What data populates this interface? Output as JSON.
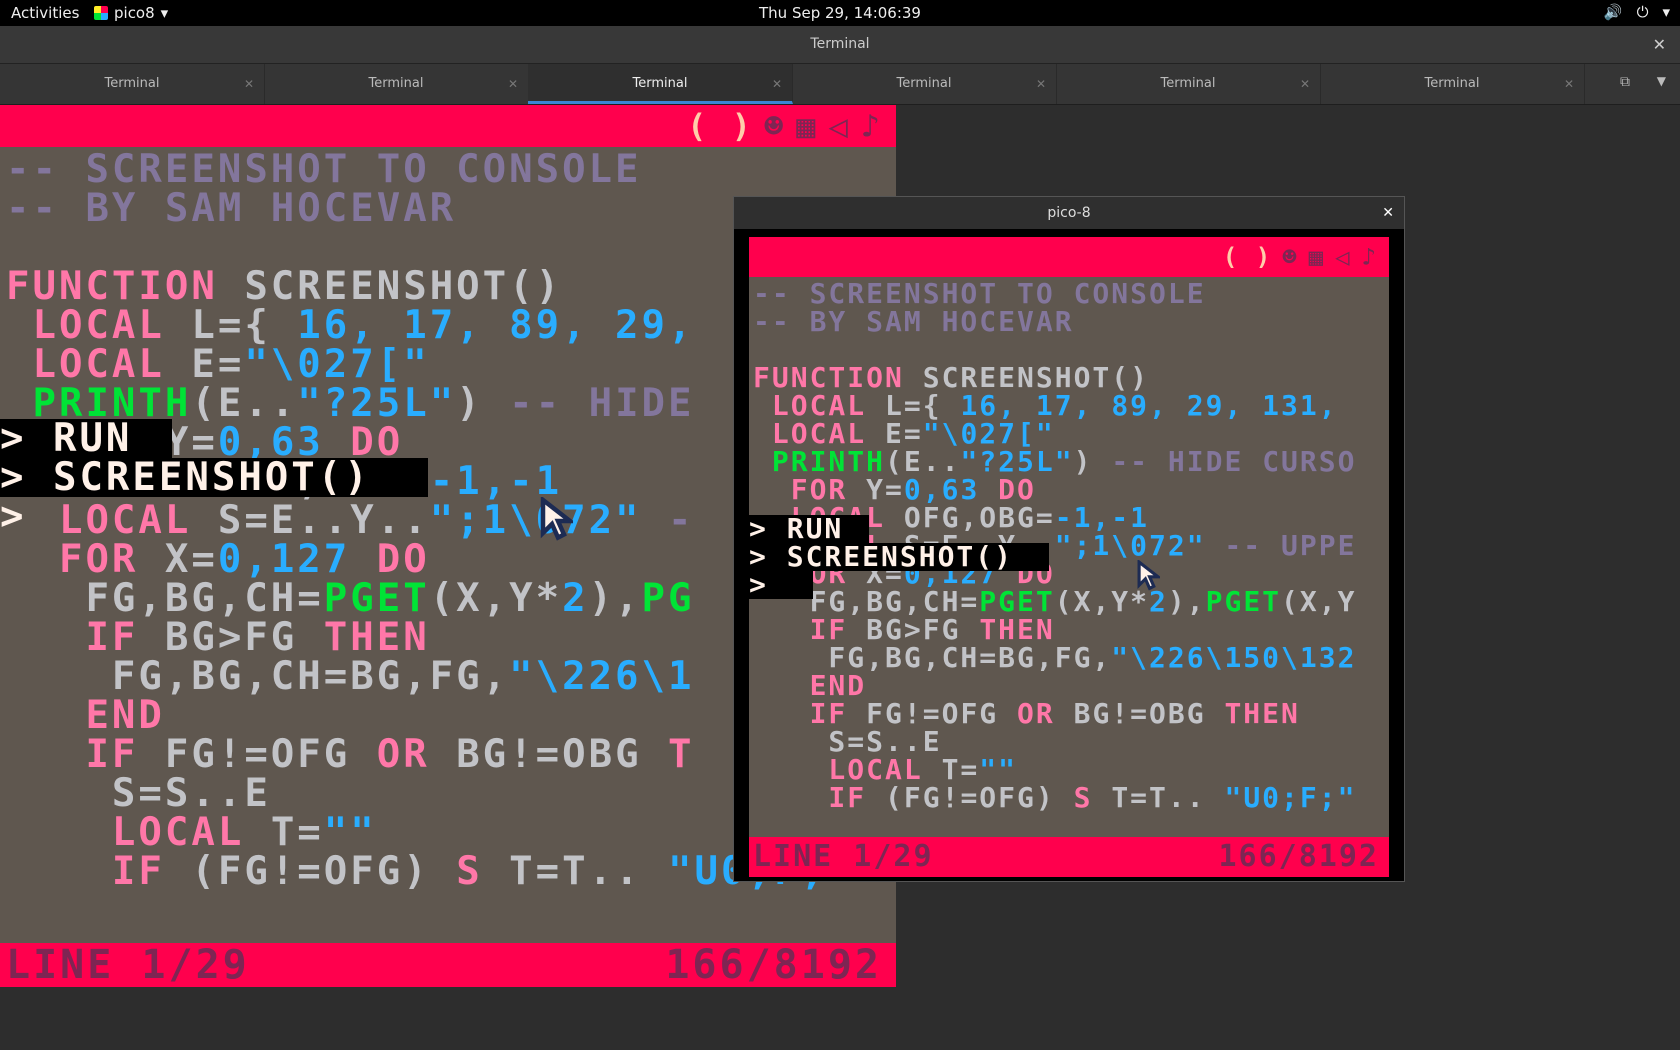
{
  "topbar": {
    "activities": "Activities",
    "app_name": "pico8",
    "app_menu_arrow": "▾",
    "clock": "Thu Sep 29, 14:06:39",
    "icons": [
      "volume-icon",
      "power-icon"
    ]
  },
  "terminal": {
    "title": "Terminal",
    "tabs": [
      {
        "label": "Terminal"
      },
      {
        "label": "Terminal"
      },
      {
        "label": "Terminal"
      },
      {
        "label": "Terminal"
      },
      {
        "label": "Terminal"
      },
      {
        "label": "Terminal"
      }
    ],
    "active_tab_index": 2
  },
  "pico_window": {
    "title": "pico-8"
  },
  "pico": {
    "editor_icons": [
      "( )",
      "☻",
      "▦",
      "◁",
      "♪"
    ],
    "status_left": "LINE 1/29",
    "status_right": "166/8192",
    "code_left": [
      {
        "parts": [
          [
            "cmt",
            "-- SCREENSHOT TO CONSOLE"
          ]
        ]
      },
      {
        "parts": [
          [
            "cmt",
            "-- BY SAM HOCEVAR"
          ]
        ]
      },
      {
        "parts": [
          [
            "id",
            ""
          ]
        ]
      },
      {
        "parts": [
          [
            "kw",
            "FUNCTION "
          ],
          [
            "id",
            "SCREENSHOT()"
          ]
        ]
      },
      {
        "parts": [
          [
            "kw",
            " LOCAL "
          ],
          [
            "id",
            "L={ "
          ],
          [
            "num",
            "16, 17, 89, 29,"
          ]
        ]
      },
      {
        "parts": [
          [
            "kw",
            " LOCAL "
          ],
          [
            "id",
            "E="
          ],
          [
            "str",
            "\"\\027[\""
          ]
        ]
      },
      {
        "parts": [
          [
            "fn",
            " PRINTH"
          ],
          [
            "id",
            "(E.."
          ],
          [
            "str",
            "\"?25L\""
          ],
          [
            "id",
            ") "
          ],
          [
            "cmt",
            "-- HIDE"
          ]
        ]
      },
      {
        "parts": [
          [
            "kw",
            "  FOR "
          ],
          [
            "id",
            "Y="
          ],
          [
            "num",
            "0,63 "
          ],
          [
            "kw",
            "DO"
          ]
        ]
      },
      {
        "parts": [
          [
            "kw",
            "  LOCAL "
          ],
          [
            "id",
            "OFG,OBG="
          ],
          [
            "num",
            "-1,-1"
          ]
        ]
      },
      {
        "parts": [
          [
            "kw",
            "  LOCAL "
          ],
          [
            "id",
            "S=E..Y.."
          ],
          [
            "str",
            "\";1\\072\""
          ],
          [
            "cmt",
            " -"
          ]
        ]
      },
      {
        "parts": [
          [
            "kw",
            "  FOR "
          ],
          [
            "id",
            "X="
          ],
          [
            "num",
            "0,127 "
          ],
          [
            "kw",
            "DO"
          ]
        ]
      },
      {
        "parts": [
          [
            "id",
            "   FG,BG,CH="
          ],
          [
            "fn",
            "PGET"
          ],
          [
            "id",
            "(X,Y*"
          ],
          [
            "num",
            "2"
          ],
          [
            "id",
            "),"
          ],
          [
            "fn",
            "PG"
          ]
        ]
      },
      {
        "parts": [
          [
            "kw",
            "   IF "
          ],
          [
            "id",
            "BG>FG "
          ],
          [
            "kw",
            "THEN"
          ]
        ]
      },
      {
        "parts": [
          [
            "id",
            "    FG,BG,CH=BG,FG,"
          ],
          [
            "str",
            "\"\\226\\1"
          ]
        ]
      },
      {
        "parts": [
          [
            "kw",
            "   END"
          ]
        ]
      },
      {
        "parts": [
          [
            "kw",
            "   IF "
          ],
          [
            "id",
            "FG!=OFG "
          ],
          [
            "kw",
            "OR "
          ],
          [
            "id",
            "BG!=OBG "
          ],
          [
            "kw",
            "T"
          ]
        ]
      },
      {
        "parts": [
          [
            "id",
            "    S=S..E"
          ]
        ]
      },
      {
        "parts": [
          [
            "kw",
            "    LOCAL "
          ],
          [
            "id",
            "T="
          ],
          [
            "str",
            "\"\""
          ]
        ]
      },
      {
        "parts": [
          [
            "kw",
            "    IF "
          ],
          [
            "id",
            "(FG!=OFG) "
          ],
          [
            "kw",
            "S "
          ],
          [
            "id",
            "T=T.. "
          ],
          [
            "str",
            "\"U0;F;\""
          ]
        ]
      }
    ],
    "code_right": [
      {
        "parts": [
          [
            "cmt",
            "-- SCREENSHOT TO CONSOLE"
          ]
        ]
      },
      {
        "parts": [
          [
            "cmt",
            "-- BY SAM HOCEVAR"
          ]
        ]
      },
      {
        "parts": [
          [
            "id",
            ""
          ]
        ]
      },
      {
        "parts": [
          [
            "kw",
            "FUNCTION "
          ],
          [
            "id",
            "SCREENSHOT()"
          ]
        ]
      },
      {
        "parts": [
          [
            "kw",
            " LOCAL "
          ],
          [
            "id",
            "L={ "
          ],
          [
            "num",
            "16, 17, 89, 29, 131,"
          ]
        ]
      },
      {
        "parts": [
          [
            "kw",
            " LOCAL "
          ],
          [
            "id",
            "E="
          ],
          [
            "str",
            "\"\\027[\""
          ]
        ]
      },
      {
        "parts": [
          [
            "fn",
            " PRINTH"
          ],
          [
            "id",
            "(E.."
          ],
          [
            "str",
            "\"?25L\""
          ],
          [
            "id",
            ") "
          ],
          [
            "cmt",
            "-- HIDE CURSO"
          ]
        ]
      },
      {
        "parts": [
          [
            "kw",
            "  FOR "
          ],
          [
            "id",
            "Y="
          ],
          [
            "num",
            "0,63 "
          ],
          [
            "kw",
            "DO"
          ]
        ]
      },
      {
        "parts": [
          [
            "kw",
            "  LOCAL "
          ],
          [
            "id",
            "OFG,OBG="
          ],
          [
            "num",
            "-1,-1"
          ]
        ]
      },
      {
        "parts": [
          [
            "kw",
            "  LOCAL "
          ],
          [
            "id",
            "S=E..Y.."
          ],
          [
            "str",
            "\";1\\072\""
          ],
          [
            "cmt",
            " -- UPPE"
          ]
        ]
      },
      {
        "parts": [
          [
            "kw",
            "  FOR "
          ],
          [
            "id",
            "X="
          ],
          [
            "num",
            "0,127 "
          ],
          [
            "kw",
            "DO"
          ]
        ]
      },
      {
        "parts": [
          [
            "id",
            "   FG,BG,CH="
          ],
          [
            "fn",
            "PGET"
          ],
          [
            "id",
            "(X,Y*"
          ],
          [
            "num",
            "2"
          ],
          [
            "id",
            "),"
          ],
          [
            "fn",
            "PGET"
          ],
          [
            "id",
            "(X,Y"
          ]
        ]
      },
      {
        "parts": [
          [
            "kw",
            "   IF "
          ],
          [
            "id",
            "BG>FG "
          ],
          [
            "kw",
            "THEN"
          ]
        ]
      },
      {
        "parts": [
          [
            "id",
            "    FG,BG,CH=BG,FG,"
          ],
          [
            "str",
            "\"\\226\\150\\132"
          ]
        ]
      },
      {
        "parts": [
          [
            "kw",
            "   END"
          ]
        ]
      },
      {
        "parts": [
          [
            "kw",
            "   IF "
          ],
          [
            "id",
            "FG!=OFG "
          ],
          [
            "kw",
            "OR "
          ],
          [
            "id",
            "BG!=OBG "
          ],
          [
            "kw",
            "THEN"
          ]
        ]
      },
      {
        "parts": [
          [
            "id",
            "    S=S..E"
          ]
        ]
      },
      {
        "parts": [
          [
            "kw",
            "    LOCAL "
          ],
          [
            "id",
            "T="
          ],
          [
            "str",
            "\"\""
          ]
        ]
      },
      {
        "parts": [
          [
            "kw",
            "    IF "
          ],
          [
            "id",
            "(FG!=OFG) "
          ],
          [
            "kw",
            "S "
          ],
          [
            "id",
            "T=T.. "
          ],
          [
            "str",
            "\"U0;F;\""
          ]
        ]
      }
    ],
    "console_lines": [
      "> RUN",
      "> SCREENSHOT()",
      ">"
    ]
  },
  "colors": {
    "pico_red": "#ff004d",
    "pico_dark_purple": "#7e2553",
    "pico_bg": "#5f574f",
    "tab_accent": "#3a86d4"
  }
}
